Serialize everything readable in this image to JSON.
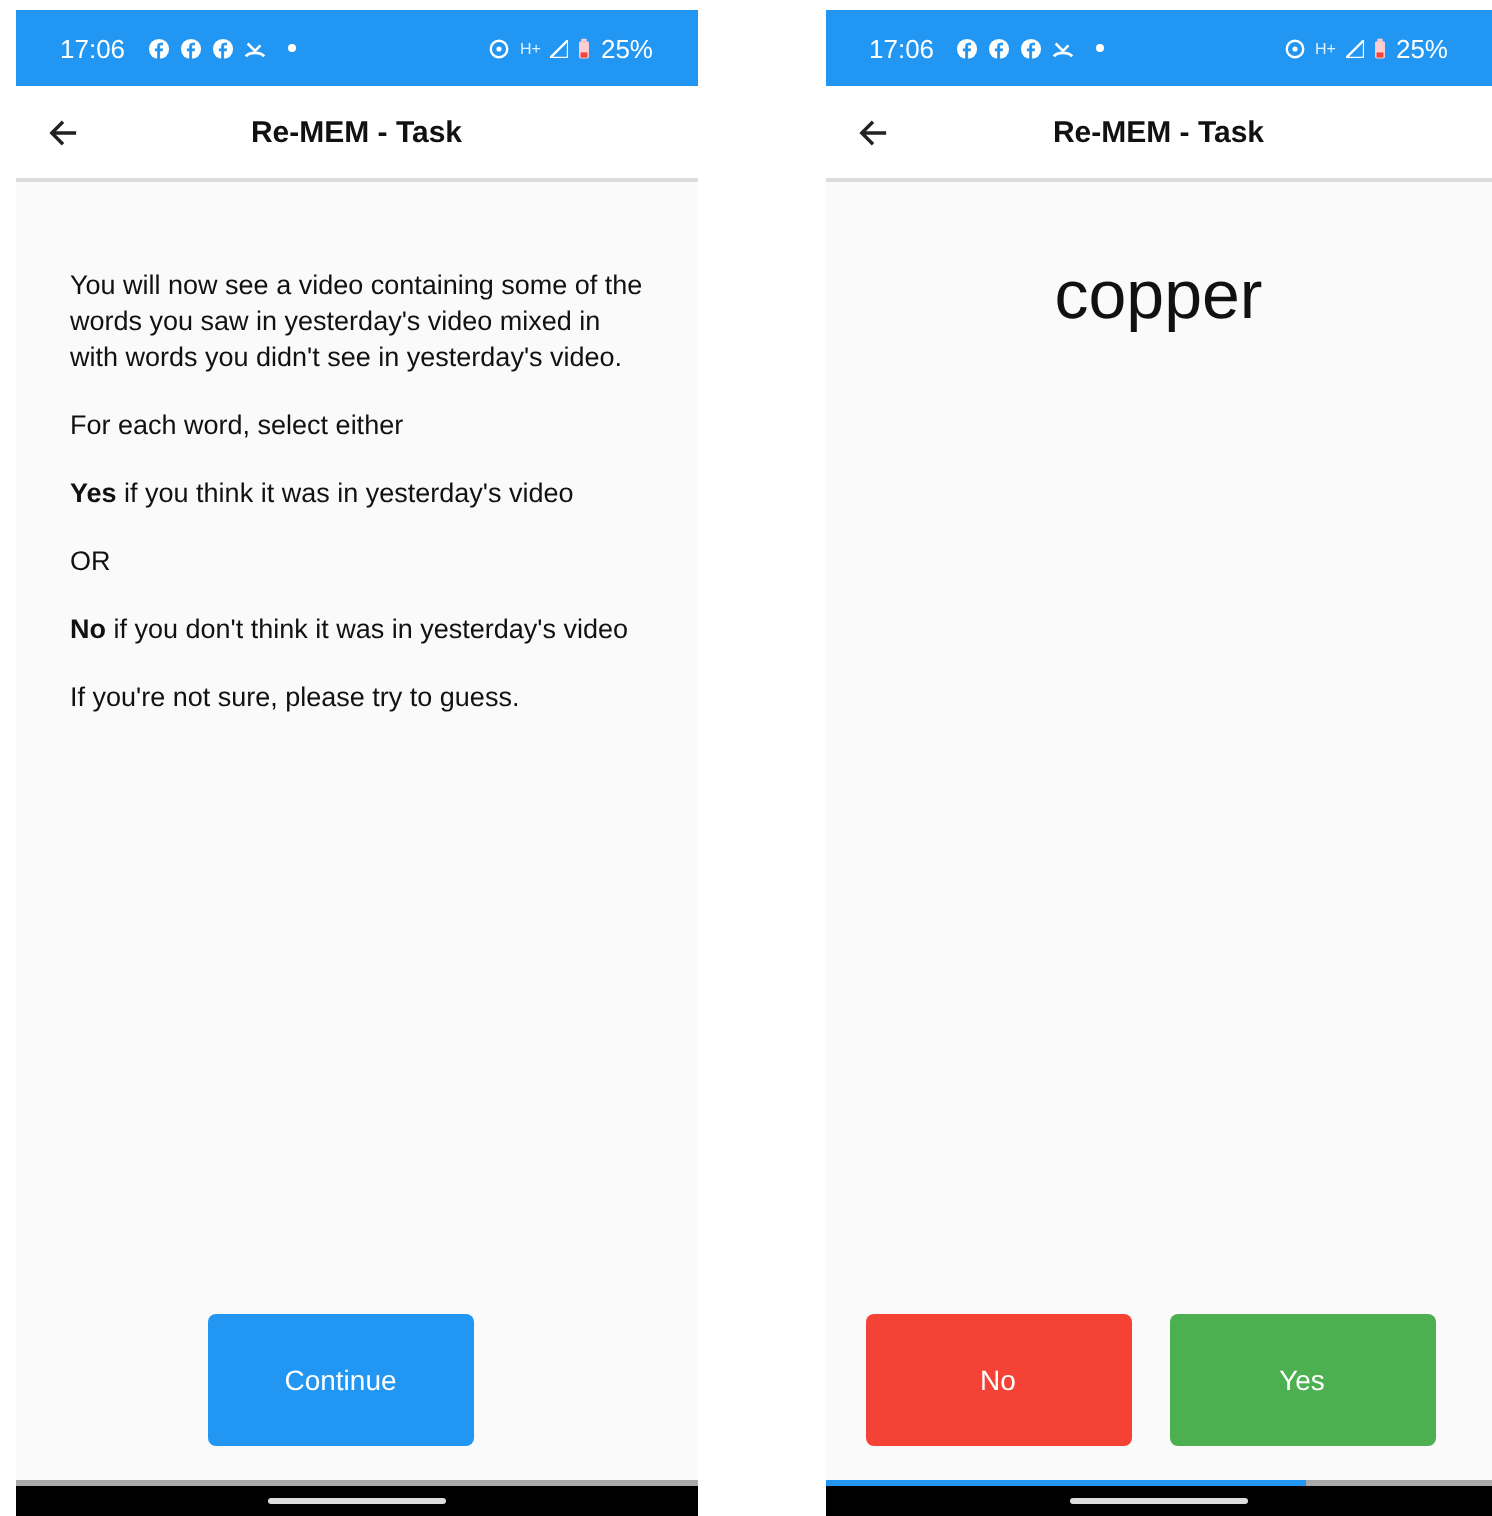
{
  "screens": [
    {
      "status_bar": {
        "time": "17:06",
        "network": "H+",
        "battery": "25%"
      },
      "app_bar": {
        "title": "Re-MEM - Task"
      },
      "paragraphs": [
        "You will now see a video containing some of the words you saw in yesterday's video mixed in with words you didn't see in yesterday's video.",
        "For each word, select either",
        "**Yes** if you think it was in yesterday's video",
        "OR",
        "**No** if you don't think it was in yesterday's video",
        "If you're not sure, please try to guess."
      ],
      "buttons": [
        {
          "label": "Continue",
          "color": "#2196f3"
        }
      ]
    },
    {
      "status_bar": {
        "time": "17:06",
        "network": "H+",
        "battery": "25%"
      },
      "app_bar": {
        "title": "Re-MEM - Task"
      },
      "word": "copper",
      "buttons": [
        {
          "label": "No",
          "color": "#f44336"
        },
        {
          "label": "Yes",
          "color": "#4caf50"
        }
      ],
      "progress": {
        "level": 0.72
      }
    }
  ]
}
